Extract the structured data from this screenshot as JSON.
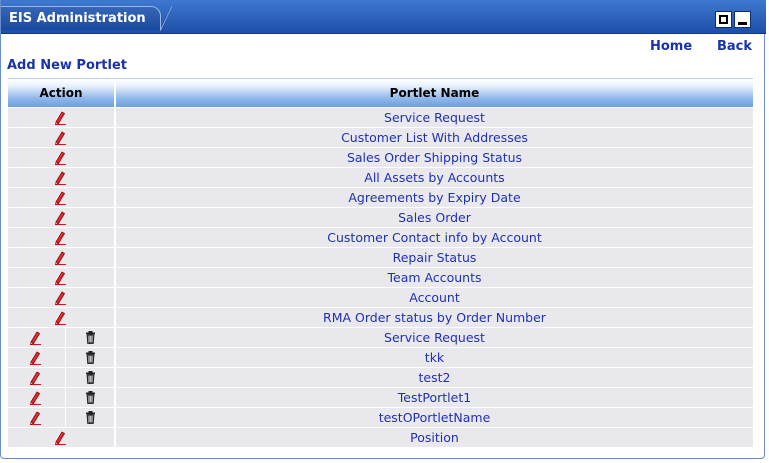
{
  "window": {
    "title": "EIS Administration",
    "restore_icon": "restore-icon",
    "minimize_icon": "minimize-icon"
  },
  "nav": {
    "home": "Home",
    "back": "Back",
    "add_new": "Add New Portlet"
  },
  "table": {
    "headers": {
      "action": "Action",
      "name": "Portlet Name"
    },
    "rows": [
      {
        "name": "Service Request",
        "deletable": false
      },
      {
        "name": "Customer List With Addresses",
        "deletable": false
      },
      {
        "name": "Sales Order Shipping Status",
        "deletable": false
      },
      {
        "name": "All Assets by Accounts",
        "deletable": false
      },
      {
        "name": "Agreements by Expiry Date",
        "deletable": false
      },
      {
        "name": "Sales Order",
        "deletable": false
      },
      {
        "name": "Customer Contact info by Account",
        "deletable": false
      },
      {
        "name": "Repair Status",
        "deletable": false
      },
      {
        "name": "Team Accounts",
        "deletable": false
      },
      {
        "name": "Account",
        "deletable": false
      },
      {
        "name": "RMA Order status by Order Number",
        "deletable": false
      },
      {
        "name": "Service Request",
        "deletable": true
      },
      {
        "name": "tkk",
        "deletable": true
      },
      {
        "name": "test2",
        "deletable": true
      },
      {
        "name": "TestPortlet1",
        "deletable": true
      },
      {
        "name": "testOPortletName",
        "deletable": true
      },
      {
        "name": "Position",
        "deletable": false
      }
    ]
  },
  "icons": {
    "edit": "pencil-edit-icon",
    "delete": "trash-delete-icon"
  },
  "colors": {
    "titlebar": "#2a5fbd",
    "link": "#1a33aa",
    "row_bg": "#e9e9ed",
    "header_accent": "#6c9fe2"
  }
}
